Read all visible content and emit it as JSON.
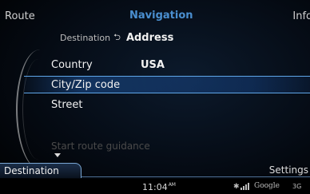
{
  "header": {
    "left_tab": "Route",
    "title": "Navigation",
    "right_tab": "Info"
  },
  "breadcrumb": {
    "parent": "Destination",
    "current": "Address"
  },
  "list": {
    "items": [
      {
        "label": "Country",
        "value": "USA"
      },
      {
        "label": "City/Zip code",
        "value": ""
      },
      {
        "label": "Street",
        "value": ""
      },
      {
        "label": "Start route guidance",
        "value": ""
      }
    ],
    "selected_index": 1
  },
  "bottom_tabs": {
    "destination": "Destination",
    "settings": "Settings"
  },
  "status": {
    "time": "11:04",
    "ampm": "AM",
    "provider": "Google",
    "network": "3G"
  },
  "icons": {
    "arrow": "return-arrow-icon",
    "bluetooth": "bluetooth-icon",
    "signal": "signal-bars-icon",
    "scroll": "scroll-down-icon"
  },
  "colors": {
    "accent": "#4a8fd0",
    "highlight": "#5fa6e8",
    "background": "#050b14"
  }
}
